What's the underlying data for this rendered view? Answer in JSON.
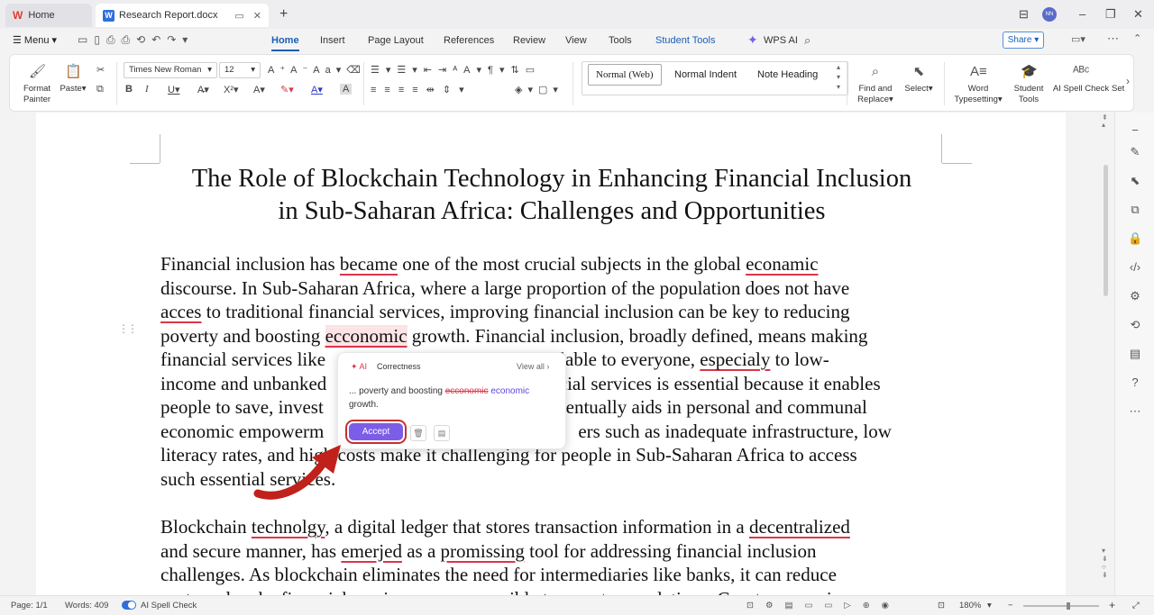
{
  "tabs": {
    "home_label": "Home",
    "doc_label": "Research Report.docx",
    "new_tab": "+"
  },
  "menu": {
    "menu_label": "Menu",
    "tabs": [
      "Home",
      "Insert",
      "Page Layout",
      "References",
      "Review",
      "View",
      "Tools",
      "Student Tools"
    ],
    "wps_ai": "WPS AI",
    "share": "Share"
  },
  "ribbon": {
    "format_painter": "Format Painter",
    "paste": "Paste",
    "font": "Times New Roman",
    "size": "12",
    "styles": [
      "Normal (Web)",
      "Normal Indent",
      "Note Heading"
    ],
    "find_replace": "Find and Replace",
    "select": "Select",
    "word_typesetting": "Word Typesetting",
    "student_tools": "Student Tools",
    "ai_spell_check": "AI Spell Check",
    "cut_off": "Set"
  },
  "document": {
    "title_line1": "The Role of Blockchain Technology in Enhancing Financial Inclusion",
    "title_line2": "in Sub-Saharan Africa: Challenges and Opportunities",
    "p1": {
      "l1a": "Financial inclusion has ",
      "l1b": "became",
      "l1c": " one of the most crucial subjects in the global ",
      "l1d": "econamic",
      "l2": "discourse. In Sub-Saharan Africa, where a large proportion of the population does not have",
      "l3a": "acces",
      "l3b": " to traditional financial services, improving financial inclusion can be key to reducing",
      "l4a": "poverty and boosting ",
      "l4b": "ecconomic",
      "l4c": " growth. Financial inclusion, broadly defined, means making",
      "l5a": "financial services like",
      "l5b": "its available to everyone, ",
      "l5c": "especialy",
      "l5d": " to low-",
      "l6a": "income and unbanked",
      "l6b": "ncial services is essential because it enables",
      "l7a": "people to save, invest",
      "l7b": "eventually aids in personal and communal",
      "l8a": "economic empowerm",
      "l8b": "ers such as inadequate infrastructure, low",
      "l9a": "literacy rates, and hi",
      "l9b": "gh costs make it challenging for people in Sub-Saharan Africa to access",
      "l10": "such essential services."
    },
    "p2": {
      "l1a": "Blockchain ",
      "l1b": "technolgy",
      "l1c": ", a digital ledger that stores transaction information in a ",
      "l1d": "decentralized",
      "l2a": "and secure manner, has ",
      "l2b": "emerjed",
      "l2c": " as a ",
      "l2d": "promissing",
      "l2e": " tool for addressing financial inclusion",
      "l3": "challenges. As blockchain eliminates the need for intermediaries like banks, it can reduce",
      "l4": "costs and make financial services more accessible to remote populations. Cryptocurrencies, a"
    }
  },
  "popup": {
    "ai_tag": "AI",
    "category": "Correctness",
    "view_all": "View all",
    "context_before": "... poverty and boosting ",
    "wrong_word": "ecconomic",
    "suggestion": "economic",
    "context_after": "growth.",
    "accept": "Accept"
  },
  "status": {
    "page": "Page: 1/1",
    "words": "Words: 409",
    "spell_check": "AI Spell Check",
    "zoom": "180%"
  },
  "colors": {
    "accent": "#1a5fb4",
    "error_underline": "#d9364a",
    "accept_button": "#7b5de8",
    "highlight_ring": "#c53030"
  }
}
